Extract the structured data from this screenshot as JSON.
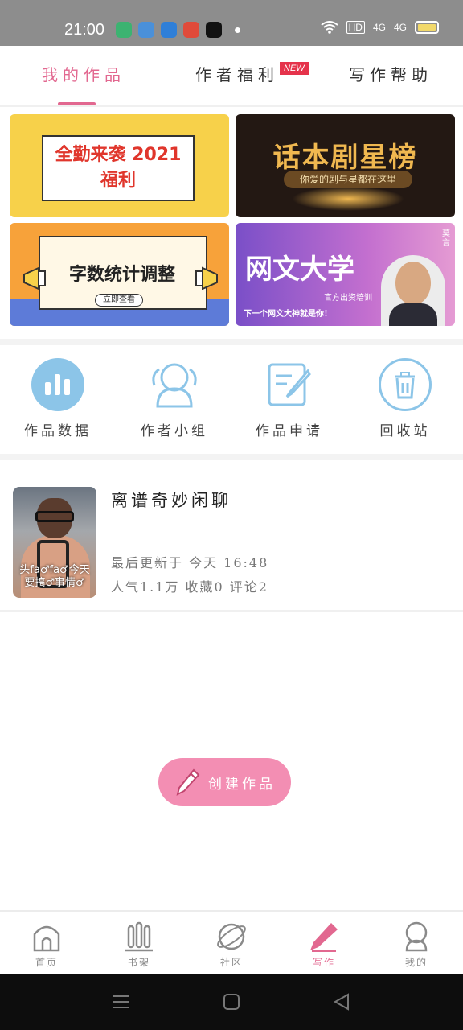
{
  "status_bar": {
    "time": "21:00",
    "right_text": [
      "HD",
      "4G",
      "4G"
    ]
  },
  "tabs": [
    {
      "label": "我的作品",
      "active": true
    },
    {
      "label": "作者福利",
      "active": false
    },
    {
      "label": "写作帮助",
      "active": false
    }
  ],
  "new_badge": "NEW",
  "banners": [
    {
      "title": "全勤来袭 2021福利"
    },
    {
      "title": "话本剧星榜",
      "subtitle": "你爱的剧与星都在这里"
    },
    {
      "title": "字数统计调整",
      "button": "立即查看"
    },
    {
      "title": "网文大学",
      "subtitle": "官方出资培训",
      "subtitle2": "下一个网文大神就是你！",
      "side": "莫言"
    }
  ],
  "actions": [
    {
      "label": "作品数据",
      "icon": "bar-chart-icon"
    },
    {
      "label": "作者小组",
      "icon": "group-icon"
    },
    {
      "label": "作品申请",
      "icon": "edit-document-icon"
    },
    {
      "label": "回收站",
      "icon": "trash-icon"
    }
  ],
  "work": {
    "title": "离谱奇妙闲聊",
    "updated": "最后更新于 今天 16:48",
    "stats": "人气1.1万 收藏0 评论2",
    "thumb_caption": "头fa♂fa♂今天要搞♂事情♂"
  },
  "create_button": "创建作品",
  "bottom_nav": [
    {
      "label": "首页",
      "icon": "home-icon",
      "active": false
    },
    {
      "label": "书架",
      "icon": "bookshelf-icon",
      "active": false
    },
    {
      "label": "社区",
      "icon": "planet-icon",
      "active": false
    },
    {
      "label": "写作",
      "icon": "pen-icon",
      "active": true
    },
    {
      "label": "我的",
      "icon": "profile-icon",
      "active": false
    }
  ],
  "colors": {
    "accent": "#e26890",
    "icon_blue": "#8cc5e8",
    "create_button": "#f38eb3"
  }
}
